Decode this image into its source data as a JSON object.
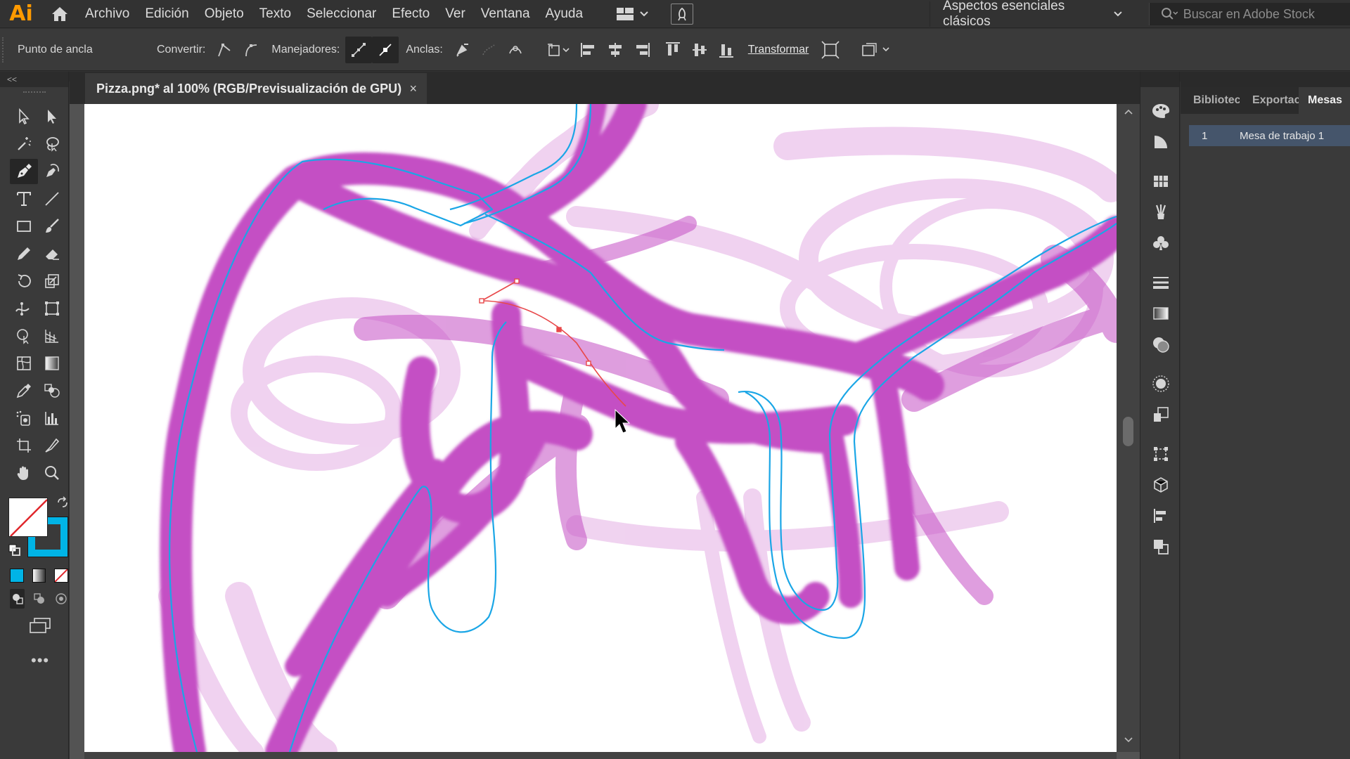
{
  "app": {
    "logo_text": "Ai",
    "menu": [
      "Archivo",
      "Edición",
      "Objeto",
      "Texto",
      "Seleccionar",
      "Efecto",
      "Ver",
      "Ventana",
      "Ayuda"
    ],
    "workspace": "Aspectos esenciales clásicos",
    "stock_search_placeholder": "Buscar en Adobe Stock"
  },
  "control_bar": {
    "selection_label": "Punto de ancla",
    "convert_label": "Convertir:",
    "handles_label": "Manejadores:",
    "anchors_label": "Anclas:",
    "transform_label": "Transformar"
  },
  "document": {
    "tab_title": "Pizza.png* al 100% (RGB/Previsualización de GPU)",
    "close_glyph": "×"
  },
  "tools": {
    "collapse_glyph": "<<",
    "more_glyph": "•••"
  },
  "artboards_panel": {
    "tabs": [
      "Bibliotec",
      "Exportaci",
      "Mesas"
    ],
    "active_tab": "Mesas",
    "rows": [
      {
        "number": "1",
        "name": "Mesa de trabajo 1"
      }
    ]
  },
  "colors": {
    "stroke_color": "#00b4e6",
    "brush_magenta": "#c44fc4",
    "path_cyan": "#1aa6e6",
    "active_path_red": "#e8484a",
    "accent_logo": "#ff9a00"
  }
}
